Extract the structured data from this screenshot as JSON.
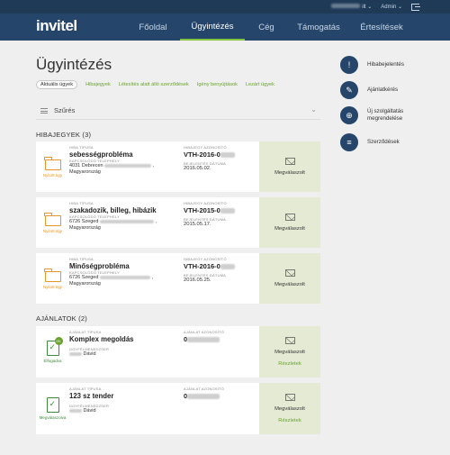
{
  "topbar": {
    "user_suffix": "ilt",
    "admin_label": "Admin"
  },
  "logo": {
    "text": "invitel"
  },
  "nav": [
    {
      "label": "Főoldal",
      "active": false
    },
    {
      "label": "Ügyintézés",
      "active": true
    },
    {
      "label": "Cég",
      "active": false
    },
    {
      "label": "Támogatás",
      "active": false
    },
    {
      "label": "Értesítések",
      "active": false
    }
  ],
  "page_title": "Ügyintézés",
  "subtabs": {
    "pill": "Aktuális ügyek",
    "links": [
      "Hibajegyek",
      "Létesítés alatt álló szerződések",
      "Igény benyújtások",
      "Lezárt ügyek"
    ]
  },
  "filter": {
    "label": "Szűrés"
  },
  "sections": {
    "tickets_title": "HIBAJEGYEK (3)",
    "offers_title": "AJÁNLATOK (2)"
  },
  "labels": {
    "ticket_type": "HIBA TÍPUSA",
    "ticket_id": "HIBAJEGY AZONOSÍTÓ",
    "site": "KAPCSOLÓDÓ TELEPHELY",
    "reported_date": "BEJELENTÉS DÁTUMA",
    "offer_type": "AJÁNLAT TÍPUSA",
    "offer_id": "AJÁNLAT AZONOSÍTÓ",
    "contact": "ÜGYFÉLMENEDZSER"
  },
  "tickets": [
    {
      "status": "Nyitott ügy",
      "type": "sebességprobléma",
      "addr1": "4031 Debrecen",
      "addr2": "Magyarország",
      "ref": "VTH-2016-0",
      "date": "2016.05.02.",
      "action": "Megválaszolt"
    },
    {
      "status": "Nyitott ügy",
      "type": "szakadozik, billeg, hibázik",
      "addr1": "6726 Szeged",
      "addr2": "Magyarország",
      "ref": "VTH-2015-0",
      "date": "2015.05.17.",
      "action": "Megválaszolt"
    },
    {
      "status": "Nyitott ügy",
      "type": "Minőségprobléma",
      "addr1": "6726 Szeged",
      "addr2": "Magyarország",
      "ref": "VTH-2016-0",
      "date": "2016.05.25.",
      "action": "Megválaszolt"
    }
  ],
  "offers": [
    {
      "status": "Elfogadva",
      "badge": "OK",
      "type": "Komplex megoldás",
      "ref": "0",
      "contact": "Dávid",
      "action": "Megválaszolt",
      "details": "Részletek"
    },
    {
      "status": "Megválaszolva",
      "badge": "",
      "type": "123 sz tender",
      "ref": "0",
      "contact": "Dávid",
      "action": "Megválaszolt",
      "details": "Részletek"
    }
  ],
  "right_menu": [
    {
      "icon": "alert-icon",
      "glyph": "!",
      "label": "Hibabejelentés"
    },
    {
      "icon": "offer-icon",
      "glyph": "✎",
      "label": "Ajánlatkérés"
    },
    {
      "icon": "cart-icon",
      "glyph": "⊕",
      "label": "Új szolgáltatás megrendelése"
    },
    {
      "icon": "contract-icon",
      "glyph": "≡",
      "label": "Szerződések"
    }
  ]
}
